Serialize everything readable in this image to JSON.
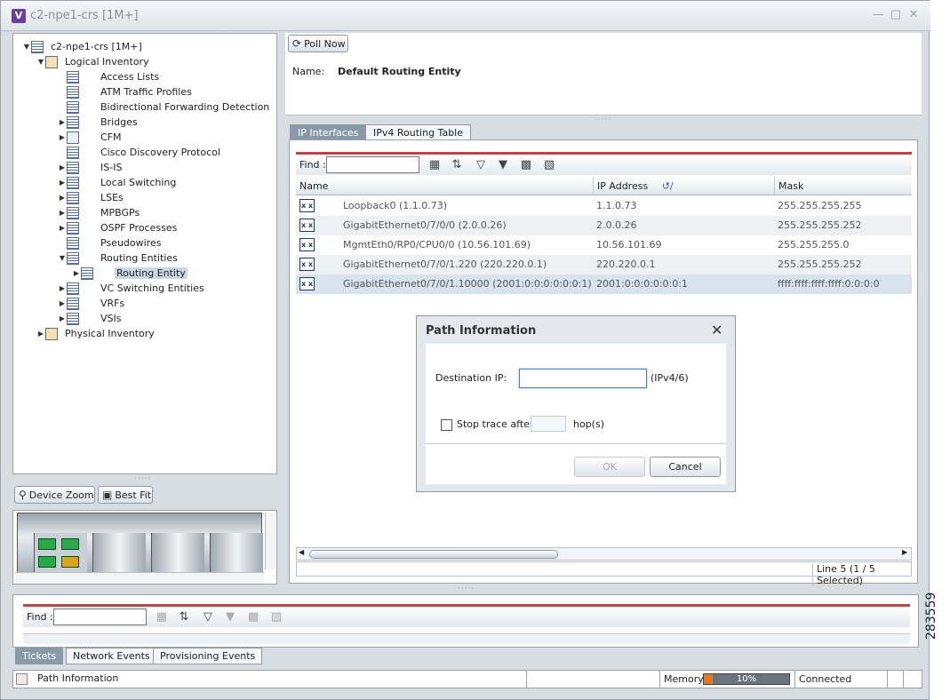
{
  "window": {
    "title": "c2-npe1-crs [1M+]",
    "app_icon": "V"
  },
  "tree": [
    {
      "label": "c2-npe1-crs [1M+]",
      "level": 0,
      "arrow": "▼",
      "icon": "device"
    },
    {
      "label": "Logical Inventory",
      "level": 1,
      "arrow": "▼",
      "icon": "sq"
    },
    {
      "label": "Access Lists",
      "level": 2,
      "arrow": "",
      "icon": "list"
    },
    {
      "label": "ATM Traffic Profiles",
      "level": 2,
      "arrow": "",
      "icon": "list"
    },
    {
      "label": "Bidirectional Forwarding Detection",
      "level": 2,
      "arrow": "",
      "icon": "list"
    },
    {
      "label": "Bridges",
      "level": 2,
      "arrow": "▶",
      "icon": "list"
    },
    {
      "label": "CFM",
      "level": 2,
      "arrow": "▶",
      "icon": "tl"
    },
    {
      "label": "Cisco Discovery Protocol",
      "level": 2,
      "arrow": "",
      "icon": "list"
    },
    {
      "label": "IS-IS",
      "level": 2,
      "arrow": "▶",
      "icon": "list"
    },
    {
      "label": "Local Switching",
      "level": 2,
      "arrow": "▶",
      "icon": "list"
    },
    {
      "label": "LSEs",
      "level": 2,
      "arrow": "▶",
      "icon": "list"
    },
    {
      "label": "MPBGPs",
      "level": 2,
      "arrow": "▶",
      "icon": "list"
    },
    {
      "label": "OSPF Processes",
      "level": 2,
      "arrow": "▶",
      "icon": "list"
    },
    {
      "label": "Pseudowires",
      "level": 2,
      "arrow": "",
      "icon": "list"
    },
    {
      "label": "Routing Entities",
      "level": 2,
      "arrow": "▼",
      "icon": "list"
    },
    {
      "label": "Routing Entity",
      "level": 3,
      "arrow": "▶",
      "icon": "list",
      "selected": true
    },
    {
      "label": "VC Switching Entities",
      "level": 2,
      "arrow": "▶",
      "icon": "list"
    },
    {
      "label": "VRFs",
      "level": 2,
      "arrow": "▶",
      "icon": "list"
    },
    {
      "label": "VSIs",
      "level": 2,
      "arrow": "▶",
      "icon": "list"
    },
    {
      "label": "Physical Inventory",
      "level": 1,
      "arrow": "▶",
      "icon": "sq"
    }
  ],
  "device": {
    "zoom_label": "Device Zoom",
    "fit_label": "Best Fit"
  },
  "props": {
    "poll_label": "Poll Now",
    "name_label": "Name:",
    "name_value": "Default Routing Entity"
  },
  "tabs": [
    "IP Interfaces",
    "IPv4 Routing Table"
  ],
  "find_label": "Find :",
  "grid": {
    "columns": [
      "Name",
      "IP Address",
      "Mask"
    ],
    "rows": [
      {
        "name": "Loopback0 (1.1.0.73)",
        "ip": "1.1.0.73",
        "mask": "255.255.255.255"
      },
      {
        "name": "GigabitEthernet0/7/0/0 (2.0.0.26)",
        "ip": "2.0.0.26",
        "mask": "255.255.255.252"
      },
      {
        "name": "MgmtEth0/RP0/CPU0/0 (10.56.101.69)",
        "ip": "10.56.101.69",
        "mask": "255.255.255.0"
      },
      {
        "name": "GigabitEthernet0/7/0/1.220 (220.220.0.1)",
        "ip": "220.220.0.1",
        "mask": "255.255.255.252"
      },
      {
        "name": "GigabitEthernet0/7/0/1.10000 (2001:0:0:0:0:0:0:1)",
        "ip": "2001:0:0:0:0:0:0:1",
        "mask": "ffff:ffff:ffff:ffff:0:0:0:0"
      }
    ],
    "status": "Line 5 (1 / 5 Selected)"
  },
  "dialog": {
    "title": "Path Information",
    "dest_label": "Destination IP:",
    "dest_value": "",
    "dest_hint": "(IPv4/6)",
    "stop_label": "Stop trace after",
    "hop_label": "hop(s)",
    "ok_label": "OK",
    "cancel_label": "Cancel"
  },
  "bottom": {
    "find_label": "Find :",
    "tabs": [
      "Tickets",
      "Network Events",
      "Provisioning Events"
    ]
  },
  "statusbar": {
    "message": "Path Information",
    "memory_label": "Memory:",
    "memory_percent": 10,
    "memory_text": "10%",
    "connection": "Connected"
  },
  "figure_number": "283559",
  "colors": {
    "accent": "#8a99a8",
    "memory_fill": "#e07a2a",
    "find_border": "#b24a4a"
  }
}
